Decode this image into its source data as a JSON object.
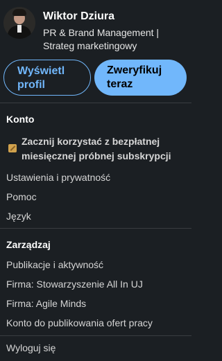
{
  "profile": {
    "name": "Wiktor Dziura",
    "headline": "PR & Brand Management | Strateg marketingowy",
    "view_profile_label": "Wyświetl profil",
    "verify_label": "Zweryfikuj teraz"
  },
  "account": {
    "title": "Konto",
    "premium_offer": "Zacznij korzystać z bezpłatnej miesięcznej próbnej subskrypcji",
    "items": [
      "Ustawienia i prywatność",
      "Pomoc",
      "Język"
    ]
  },
  "manage": {
    "title": "Zarządzaj",
    "items": [
      "Publikacje i aktywność",
      "Firma: Stowarzyszenie All In UJ",
      "Firma: Agile Minds",
      "Konto do publikowania ofert pracy"
    ]
  },
  "signout_label": "Wyloguj się",
  "colors": {
    "accent": "#71b7fb",
    "background": "#1b1f23",
    "premium_icon": "#d1a24d"
  },
  "icons": [
    "premium-icon"
  ]
}
